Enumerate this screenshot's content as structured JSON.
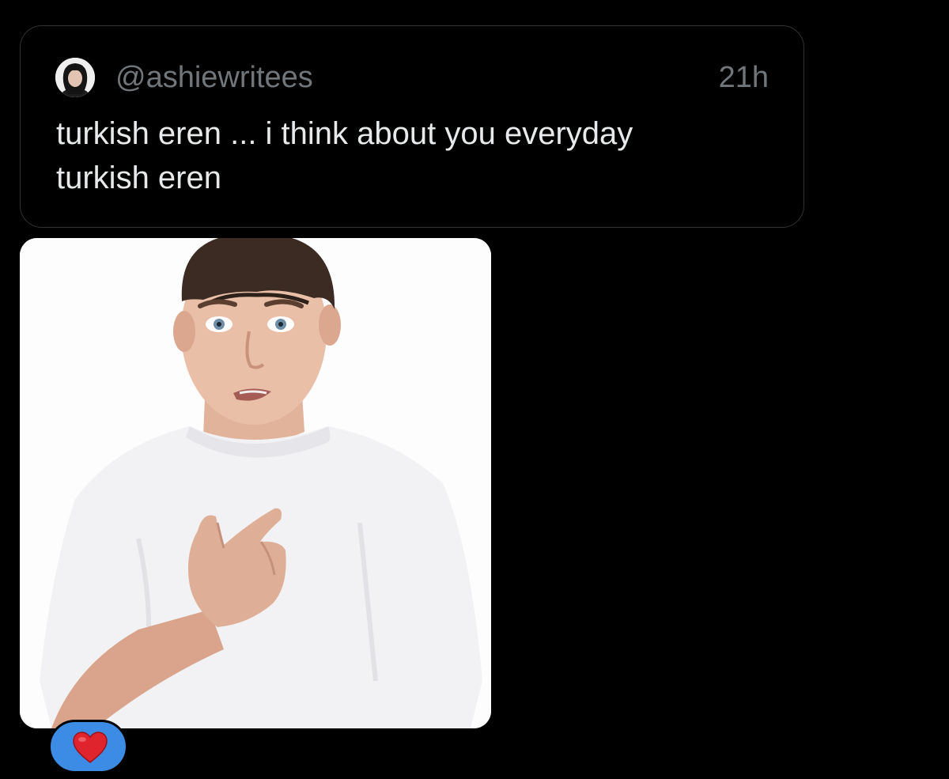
{
  "quoted_post": {
    "handle": "@ashiewritees",
    "time": "21h",
    "text_lines": [
      "turkish eren ... i think about you everyday",
      "turkish eren"
    ],
    "avatar_icon": "profile-photo-icon"
  },
  "media": {
    "icon": "photo-man-white-tshirt",
    "background_color": "#fdfdfd"
  },
  "reaction": {
    "icon": "red-heart-icon",
    "bubble_color": "#3c8be4",
    "heart_color": "#e0242e"
  },
  "colors": {
    "background": "#000000",
    "card_border": "#2f3336",
    "secondary_text": "#71767b",
    "primary_text": "#e7e9ea"
  }
}
